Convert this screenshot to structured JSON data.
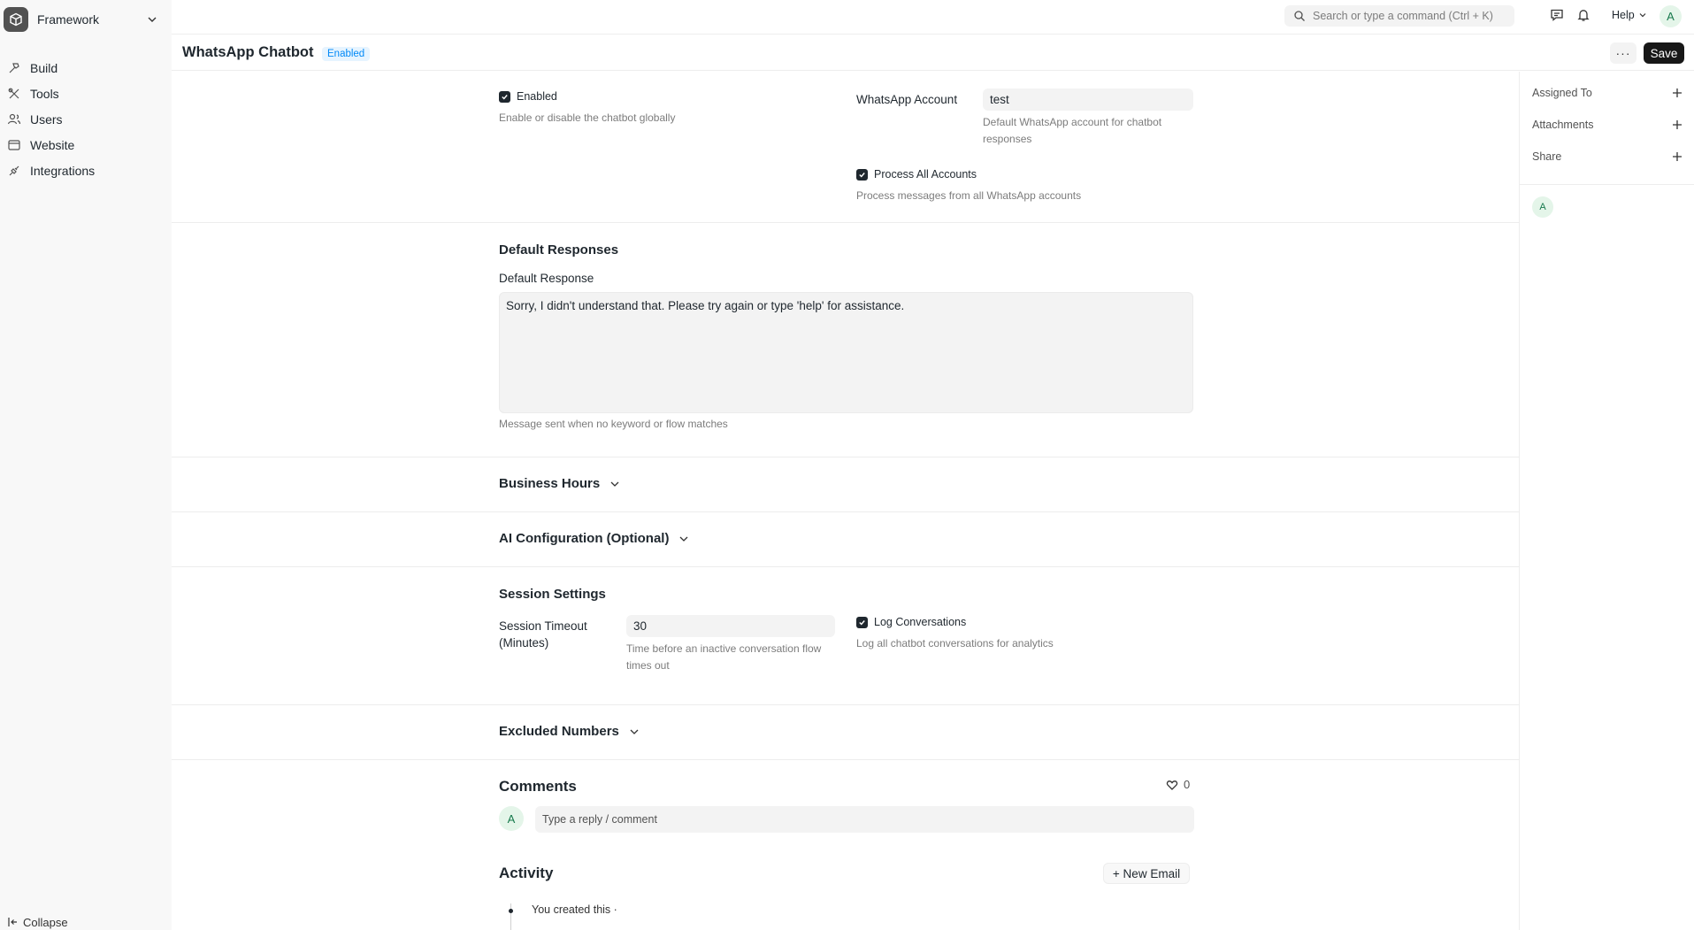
{
  "app": {
    "name": "Framework",
    "collapse_label": "Collapse"
  },
  "sidebar": {
    "items": [
      {
        "label": "Build",
        "icon": "hammer-icon"
      },
      {
        "label": "Tools",
        "icon": "tools-icon"
      },
      {
        "label": "Users",
        "icon": "users-icon"
      },
      {
        "label": "Website",
        "icon": "browser-icon"
      },
      {
        "label": "Integrations",
        "icon": "plug-icon"
      }
    ]
  },
  "topbar": {
    "search_placeholder": "Search or type a command (Ctrl + K)",
    "help_label": "Help",
    "avatar_letter": "A"
  },
  "page": {
    "title": "WhatsApp Chatbot",
    "status": "Enabled",
    "more_label": "···",
    "save_label": "Save"
  },
  "form": {
    "enabled": {
      "label": "Enabled",
      "checked": true,
      "hint": "Enable or disable the chatbot globally"
    },
    "whatsapp_account": {
      "label": "WhatsApp Account",
      "value": "test",
      "hint": "Default WhatsApp account for chatbot responses"
    },
    "process_all": {
      "label": "Process All Accounts",
      "checked": true,
      "hint": "Process messages from all WhatsApp accounts"
    },
    "default_responses": {
      "title": "Default Responses",
      "label": "Default Response",
      "value": "Sorry, I didn't understand that. Please try again or type 'help' for assistance.",
      "hint": "Message sent when no keyword or flow matches"
    },
    "business_hours": {
      "title": "Business Hours"
    },
    "ai_config": {
      "title": "AI Configuration (Optional)"
    },
    "session": {
      "title": "Session Settings",
      "timeout_label_1": "Session Timeout",
      "timeout_label_2": "(Minutes)",
      "timeout_value": "30",
      "timeout_hint_1": "Time before an inactive conversation flow",
      "timeout_hint_2": "times out",
      "log_label": "Log Conversations",
      "log_checked": true,
      "log_hint": "Log all chatbot conversations for analytics"
    },
    "excluded_numbers": {
      "title": "Excluded Numbers"
    }
  },
  "comments": {
    "title": "Comments",
    "likes": "0",
    "avatar_letter": "A",
    "placeholder": "Type a reply / comment"
  },
  "activity": {
    "title": "Activity",
    "new_email_label": "+ New Email",
    "items": [
      {
        "text": "You created this ·"
      }
    ]
  },
  "right_panel": {
    "assigned_to": "Assigned To",
    "attachments": "Attachments",
    "share": "Share",
    "avatar_letter": "A"
  }
}
